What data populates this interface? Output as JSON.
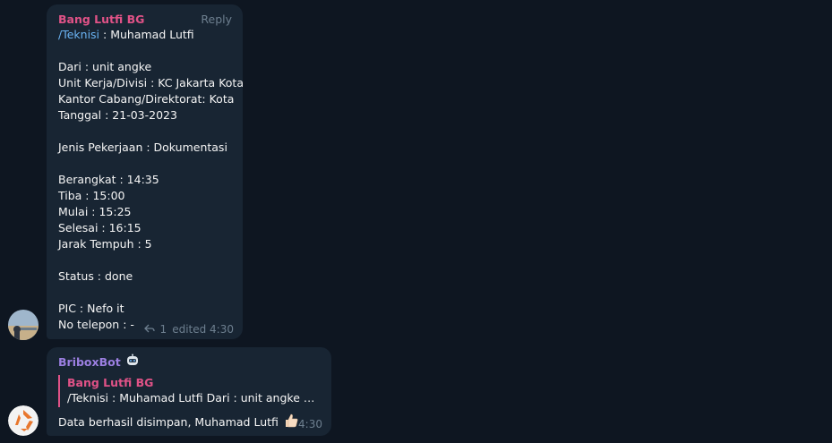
{
  "message1": {
    "sender": "Bang Lutfi BG",
    "reply_label": "Reply",
    "command": "/Teknisi",
    "lines": [
      " : Muhamad Lutfi",
      "",
      "Dari : unit angke",
      "Unit Kerja/Divisi : KC Jakarta Kota",
      "Kantor Cabang/Direktorat: Kota",
      "Tanggal : 21-03-2023",
      "",
      "Jenis Pekerjaan : Dokumentasi",
      "",
      "Berangkat : 14:35",
      "Tiba : 15:00",
      "Mulai : 15:25",
      "Selesai : 16:15",
      "Jarak Tempuh : 5",
      "",
      "Status : done",
      "",
      "PIC : Nefo it",
      "No telepon : -"
    ],
    "reply_count": "1",
    "edited": "edited 4:30"
  },
  "message2": {
    "sender": "BriboxBot",
    "quote_name": "Bang Lutfi BG",
    "quote_text": "/Teknisi : Muhamad Lutfi   Dari : unit angke Unit Kerja/Divisi : KC Jakarta Kota",
    "text": "Data berhasil disimpan, Muhamad Lutfi",
    "time": "4:30"
  },
  "icons": {
    "bot": "robot-icon",
    "reply": "reply-arrow-icon",
    "thumb": "thumbs-up-icon"
  },
  "colors": {
    "background": "#0e1621",
    "bubble": "#182533",
    "sender1": "#e05287",
    "sender2": "#9b7fe0",
    "link": "#6ab3f3"
  }
}
